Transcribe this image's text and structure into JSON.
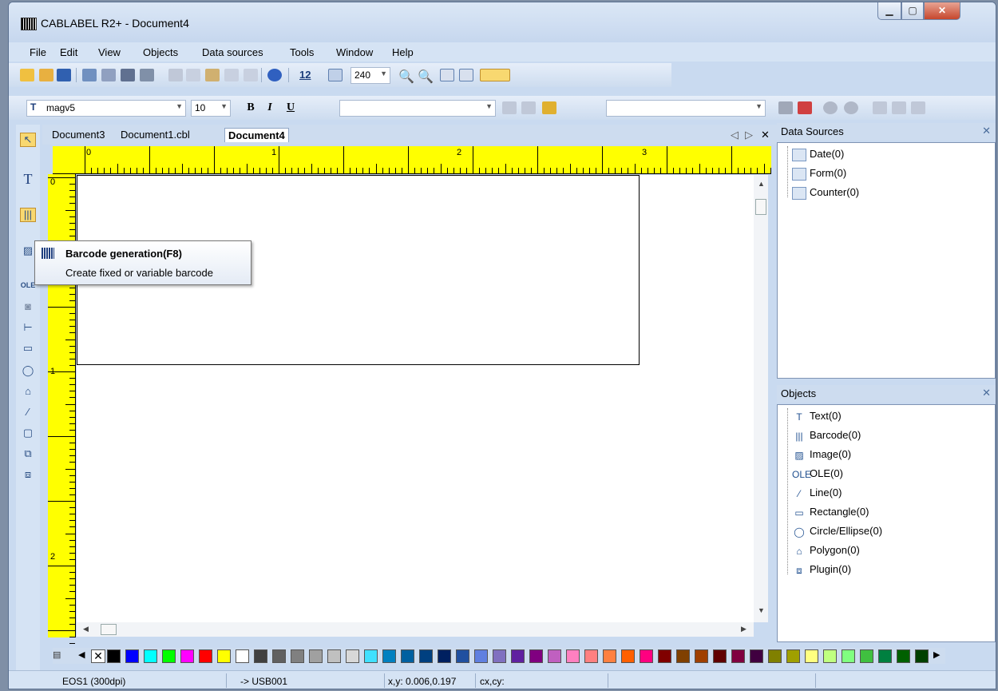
{
  "window": {
    "title": "CABLABEL R2+ - Document4"
  },
  "menu": [
    "File",
    "Edit",
    "View",
    "Objects",
    "Data sources",
    "Tools",
    "Window",
    "Help"
  ],
  "toolbar": {
    "font_size_icon": "12",
    "zoom_value": "240",
    "font_name": "magv5",
    "font_size": "10",
    "bold": "B",
    "italic": "I",
    "underline": "U"
  },
  "doc_tabs": [
    "Document3",
    "Document1.cbl",
    "Document4"
  ],
  "ruler": {
    "h": [
      "0",
      "1",
      "2",
      "3"
    ],
    "v": [
      "0",
      "1",
      "2"
    ]
  },
  "data_sources": {
    "title": "Data Sources",
    "items": [
      {
        "label": "Date(0)",
        "icon": "calendar-icon"
      },
      {
        "label": "Form(0)",
        "icon": "form-icon"
      },
      {
        "label": "Counter(0)",
        "icon": "counter-icon"
      }
    ]
  },
  "objects": {
    "title": "Objects",
    "items": [
      {
        "label": "Text(0)",
        "icon": "text-icon",
        "glyph": "T"
      },
      {
        "label": "Barcode(0)",
        "icon": "barcode-icon",
        "glyph": "|||"
      },
      {
        "label": "Image(0)",
        "icon": "image-icon",
        "glyph": "▨"
      },
      {
        "label": "OLE(0)",
        "icon": "ole-icon",
        "glyph": "OLE"
      },
      {
        "label": "Line(0)",
        "icon": "line-icon",
        "glyph": "⁄"
      },
      {
        "label": "Rectangle(0)",
        "icon": "rectangle-icon",
        "glyph": "▭"
      },
      {
        "label": "Circle/Ellipse(0)",
        "icon": "ellipse-icon",
        "glyph": "◯"
      },
      {
        "label": "Polygon(0)",
        "icon": "polygon-icon",
        "glyph": "⌂"
      },
      {
        "label": "Plugin(0)",
        "icon": "plugin-icon",
        "glyph": "⧈"
      }
    ]
  },
  "tooltip": {
    "title": "Barcode generation(F8)",
    "desc": "Create fixed or variable barcode"
  },
  "status": {
    "printer": "EOS1 (300dpi)",
    "port": "-> USB001",
    "xy": "x,y: 0.006,0.197",
    "cxcy": "cx,cy:"
  },
  "palette": [
    "#000000",
    "#0000ff",
    "#00ffff",
    "#00ff00",
    "#ff00ff",
    "#ff0000",
    "#ffff00",
    "#ffffff",
    "#404040",
    "#606060",
    "#808080",
    "#a0a0a0",
    "#c0c0c0",
    "#d8d8d8",
    "#40e0ff",
    "#0080c0",
    "#0060a0",
    "#004080",
    "#002060",
    "#2050a0",
    "#6080e0",
    "#8070c0",
    "#6020a0",
    "#800080",
    "#c060c0",
    "#ff80c0",
    "#ff8080",
    "#ff8040",
    "#ff6000",
    "#ff0080",
    "#800000",
    "#804000",
    "#a04000",
    "#600000",
    "#800040",
    "#400040",
    "#808000",
    "#a0a000",
    "#ffff80",
    "#c0ff80",
    "#80ff80",
    "#40c040",
    "#008040",
    "#006000",
    "#004000"
  ]
}
